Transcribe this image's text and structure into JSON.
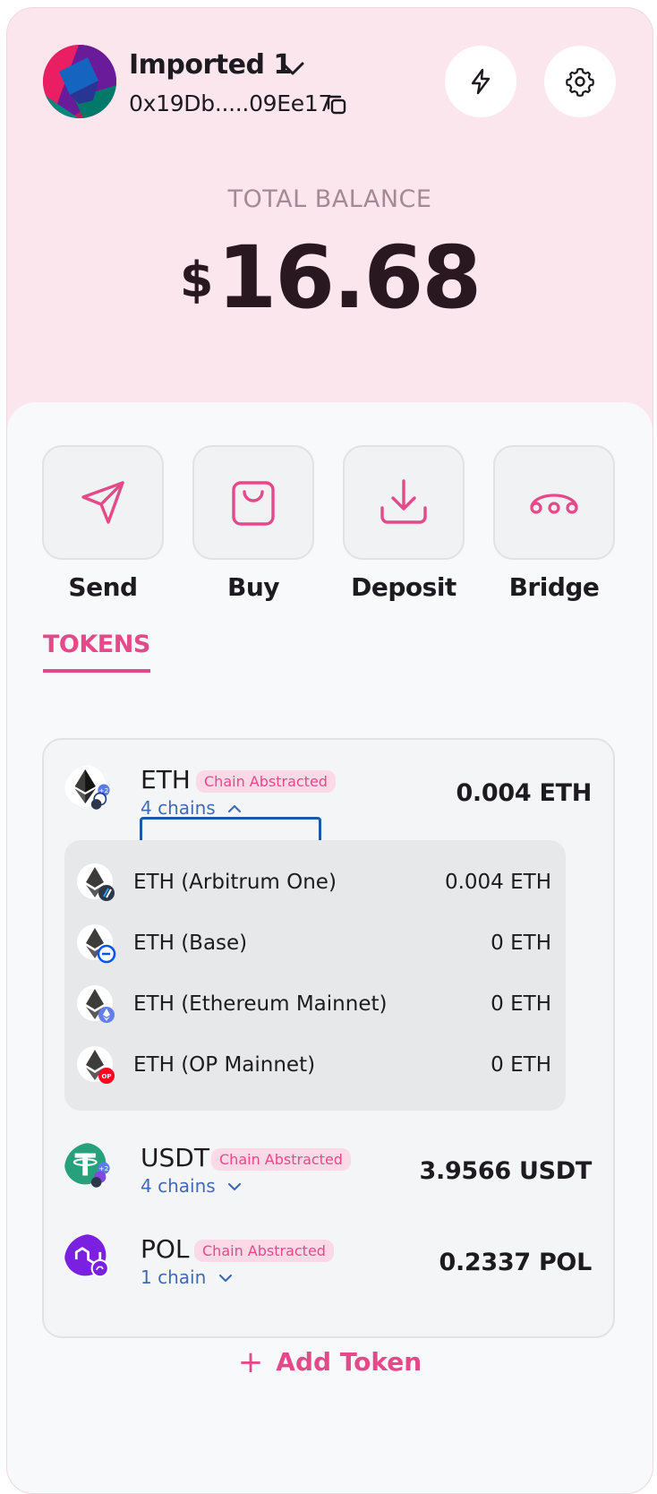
{
  "account": {
    "name": "Imported 1",
    "address": "0x19Db.....09Ee17"
  },
  "balance": {
    "label": "TOTAL BALANCE",
    "currency": "$",
    "amount": "16.68"
  },
  "actions": [
    {
      "label": "Send",
      "icon": "send-icon"
    },
    {
      "label": "Buy",
      "icon": "shopping-bag-icon"
    },
    {
      "label": "Deposit",
      "icon": "download-icon"
    },
    {
      "label": "Bridge",
      "icon": "bridge-icon"
    }
  ],
  "tabs": {
    "tokens": "TOKENS"
  },
  "tokens": [
    {
      "symbol": "ETH",
      "badge": "Chain Abstracted",
      "chains": "4 chains",
      "amount": "0.004 ETH",
      "breakdown": [
        {
          "name": "ETH (Arbitrum One)",
          "amount": "0.004 ETH"
        },
        {
          "name": "ETH (Base)",
          "amount": "0 ETH"
        },
        {
          "name": "ETH (Ethereum Mainnet)",
          "amount": "0 ETH"
        },
        {
          "name": "ETH (OP Mainnet)",
          "amount": "0 ETH"
        }
      ]
    },
    {
      "symbol": "USDT",
      "badge": "Chain Abstracted",
      "chains": "4 chains",
      "amount": "3.9566 USDT"
    },
    {
      "symbol": "POL",
      "badge": "Chain Abstracted",
      "chains": "1 chain",
      "amount": "0.2337 POL"
    }
  ],
  "add_token": "Add Token",
  "colors": {
    "accent": "#e6498a",
    "header_bg": "#fce6ee",
    "link": "#3f6bb4"
  }
}
